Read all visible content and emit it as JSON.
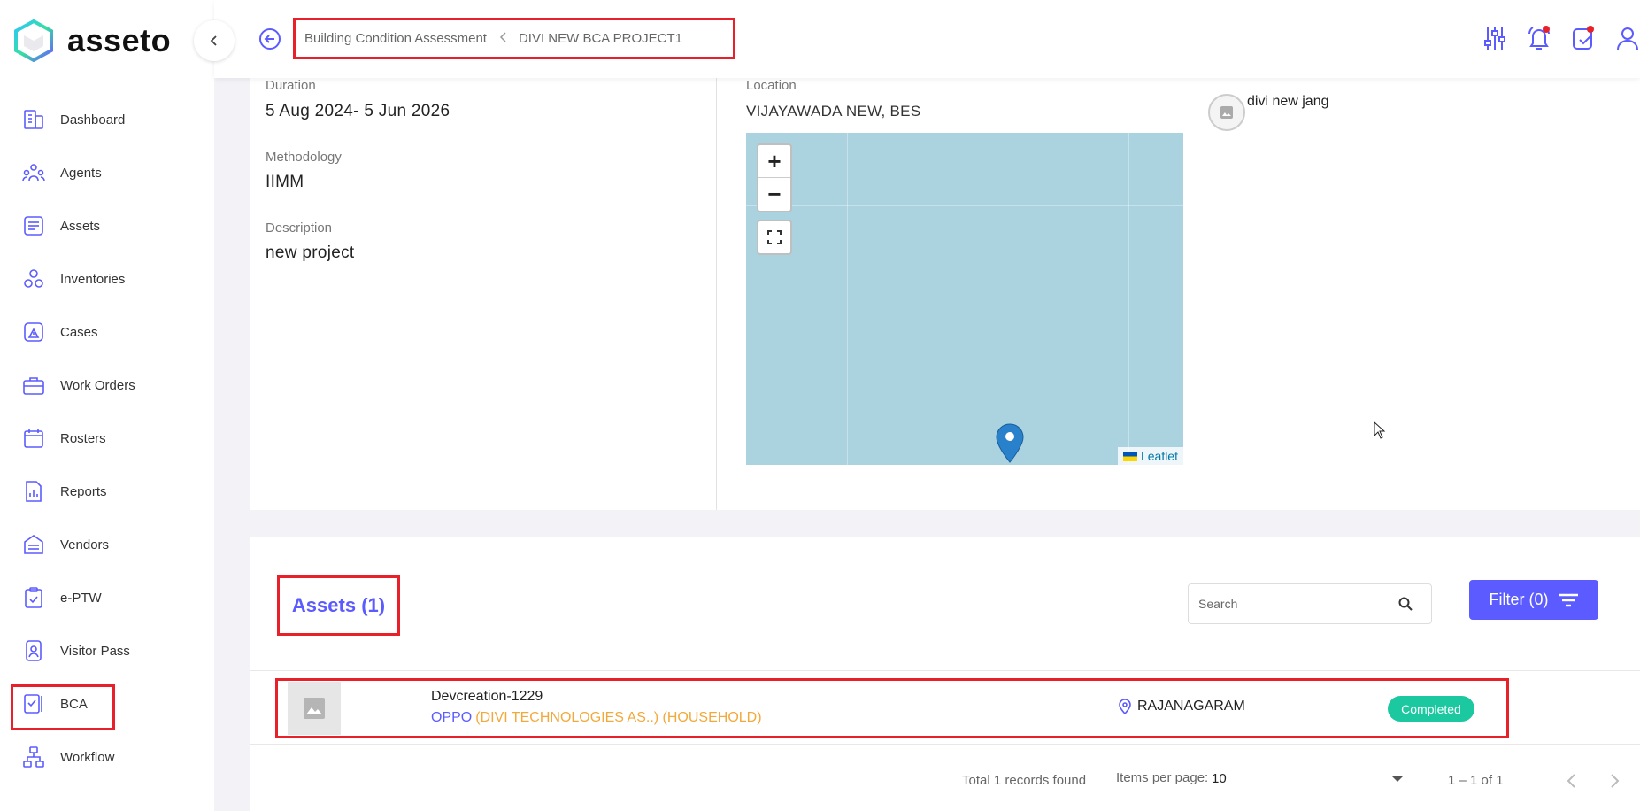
{
  "app": {
    "name": "asseto"
  },
  "sidebar": {
    "items": [
      {
        "label": "Dashboard",
        "icon": "dashboard-icon"
      },
      {
        "label": "Agents",
        "icon": "agents-icon"
      },
      {
        "label": "Assets",
        "icon": "assets-icon"
      },
      {
        "label": "Inventories",
        "icon": "inventories-icon"
      },
      {
        "label": "Cases",
        "icon": "cases-icon"
      },
      {
        "label": "Work Orders",
        "icon": "work-orders-icon"
      },
      {
        "label": "Rosters",
        "icon": "rosters-icon"
      },
      {
        "label": "Reports",
        "icon": "reports-icon"
      },
      {
        "label": "Vendors",
        "icon": "vendors-icon"
      },
      {
        "label": "e-PTW",
        "icon": "eptw-icon"
      },
      {
        "label": "Visitor Pass",
        "icon": "visitor-pass-icon"
      },
      {
        "label": "BCA",
        "icon": "bca-icon"
      },
      {
        "label": "Workflow",
        "icon": "workflow-icon"
      }
    ]
  },
  "header": {
    "breadcrumb": {
      "parent": "Building Condition Assessment",
      "current": "DIVI NEW BCA PROJECT1"
    }
  },
  "details": {
    "duration": {
      "label": "Duration",
      "value": "5 Aug 2024- 5 Jun 2026"
    },
    "methodology": {
      "label": "Methodology",
      "value": "IIMM"
    },
    "description": {
      "label": "Description",
      "value": "new project"
    },
    "location": {
      "label": "Location",
      "value": "VIJAYAWADA NEW, BES"
    },
    "map": {
      "zoom_in": "+",
      "zoom_out": "−",
      "attribution": "Leaflet"
    },
    "agent": {
      "name": "divi new jang"
    }
  },
  "assets": {
    "title": "Assets (1)",
    "search": {
      "placeholder": "Search"
    },
    "filter_label": "Filter  (0)",
    "rows": [
      {
        "name": "Devcreation-1229",
        "brand": "OPPO",
        "org": "(DIVI TECHNOLOGIES AS..) (HOUSEHOLD)",
        "location": "RAJANAGARAM",
        "status": "Completed"
      }
    ],
    "pagination": {
      "total": "Total 1 records found",
      "items_per_page_label": "Items per page:",
      "items_per_page": "10",
      "range": "1 – 1 of 1"
    }
  },
  "colors": {
    "accent": "#5b5bff",
    "status_completed": "#1bc8a0",
    "highlight": "#e8202a",
    "org_text": "#f2a93b"
  }
}
